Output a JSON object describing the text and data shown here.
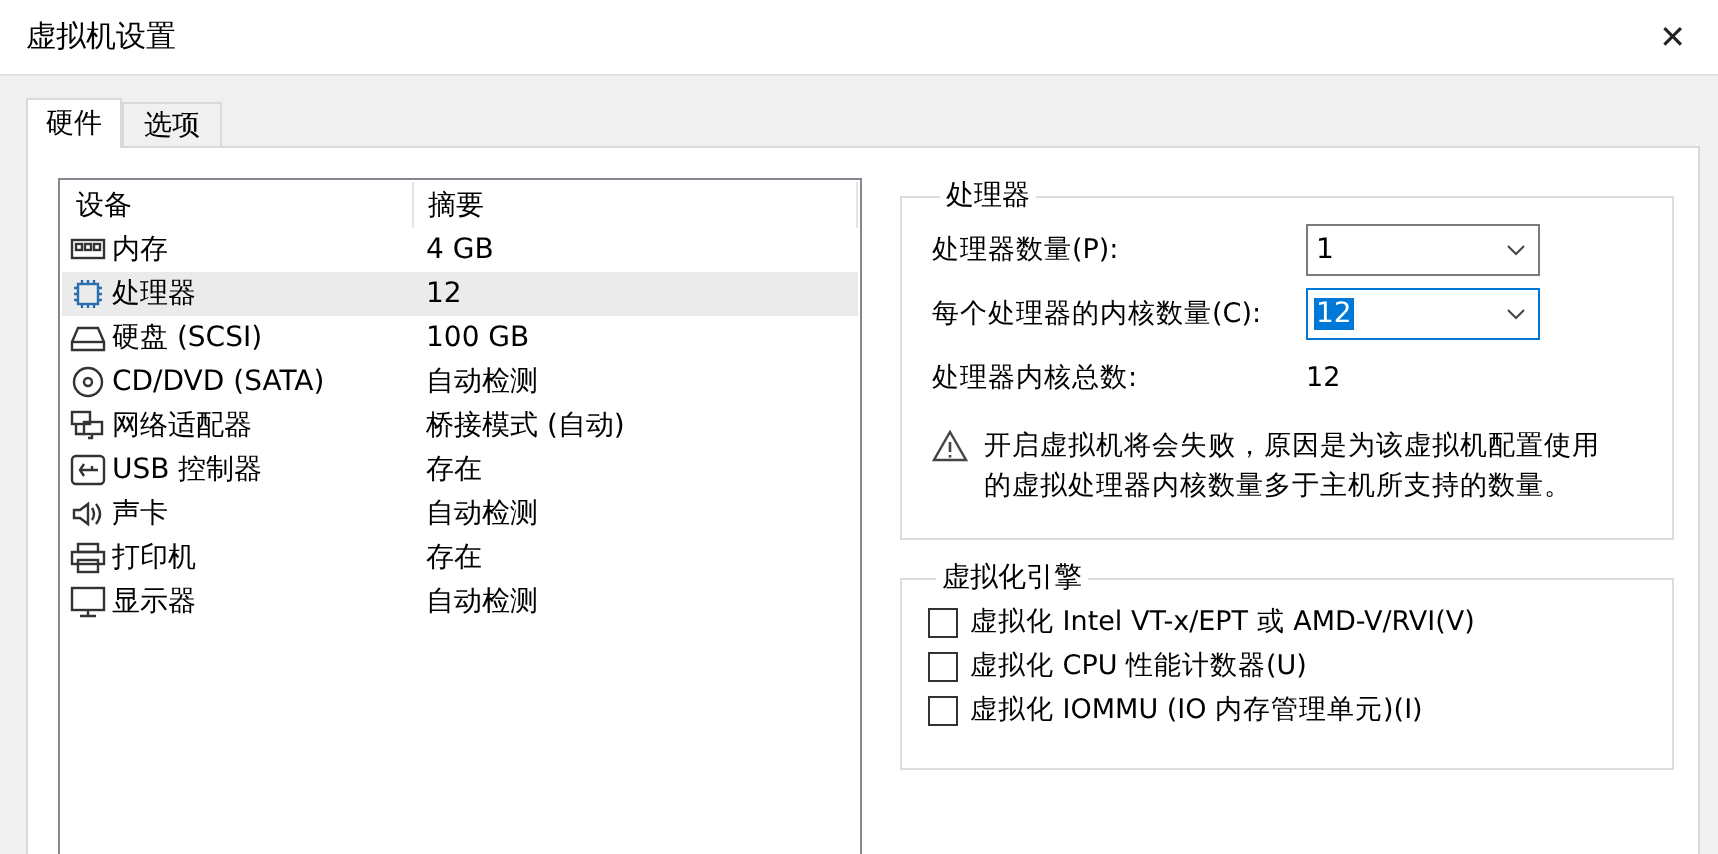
{
  "window": {
    "title": "虚拟机设置",
    "close": "✕"
  },
  "tabs": [
    {
      "label": "硬件",
      "selected": true
    },
    {
      "label": "选项",
      "selected": false
    }
  ],
  "devices": {
    "columns": [
      "设备",
      "摘要"
    ],
    "rows": [
      {
        "kind": "memory",
        "name": "内存",
        "summary": "4 GB",
        "selected": false
      },
      {
        "kind": "cpu",
        "name": "处理器",
        "summary": "12",
        "selected": true
      },
      {
        "kind": "disk",
        "name": "硬盘 (SCSI)",
        "summary": "100 GB",
        "selected": false
      },
      {
        "kind": "cd",
        "name": "CD/DVD (SATA)",
        "summary": "自动检测",
        "selected": false
      },
      {
        "kind": "network",
        "name": "网络适配器",
        "summary": "桥接模式 (自动)",
        "selected": false
      },
      {
        "kind": "usb",
        "name": "USB 控制器",
        "summary": "存在",
        "selected": false
      },
      {
        "kind": "sound",
        "name": "声卡",
        "summary": "自动检测",
        "selected": false
      },
      {
        "kind": "printer",
        "name": "打印机",
        "summary": "存在",
        "selected": false
      },
      {
        "kind": "display",
        "name": "显示器",
        "summary": "自动检测",
        "selected": false
      }
    ]
  },
  "processor": {
    "title": "处理器",
    "fields": [
      {
        "label": "处理器数量(P):",
        "value": "1",
        "focused": false
      },
      {
        "label": "每个处理器的内核数量(C):",
        "value": "12",
        "focused": true
      }
    ],
    "total_label": "处理器内核总数:",
    "total_value": "12",
    "warning": "开启虚拟机将会失败，原因是为该虚拟机配置使用的虚拟处理器内核数量多于主机所支持的数量。"
  },
  "virtualization": {
    "title": "虚拟化引擎",
    "options": [
      {
        "label": "虚拟化 Intel VT-x/EPT 或 AMD-V/RVI(V)",
        "checked": false
      },
      {
        "label": "虚拟化 CPU 性能计数器(U)",
        "checked": false
      },
      {
        "label": "虚拟化 IOMMU (IO 内存管理单元)(I)",
        "checked": false
      }
    ]
  }
}
